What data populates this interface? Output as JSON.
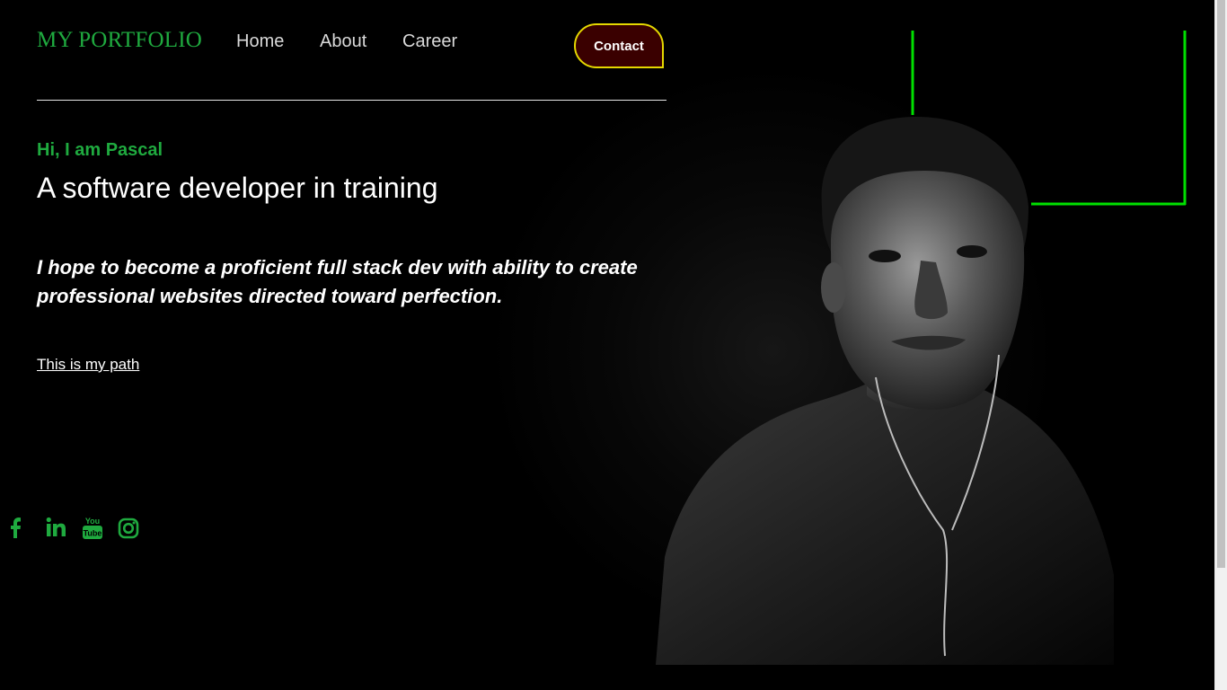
{
  "brand": {
    "logo_text": "MY PORTFOLIO"
  },
  "nav": {
    "home_label": "Home",
    "about_label": "About",
    "career_label": "Career",
    "contact_label": "Contact"
  },
  "hero": {
    "greeting": "Hi, I am Pascal",
    "headline": "A software developer in training",
    "tagline": "I hope to become a proficient full stack dev with ability to create professional websites directed toward perfection.",
    "path_link": "This is my path"
  },
  "social": [
    {
      "name": "facebook-icon"
    },
    {
      "name": "linkedin-icon"
    },
    {
      "name": "youtube-icon"
    },
    {
      "name": "instagram-icon"
    }
  ],
  "colors": {
    "background": "#000000",
    "accent_green": "#1faa3f",
    "frame_green": "#00e000",
    "contact_border": "#e5d800",
    "contact_fill": "#3a0000",
    "text_primary": "#ffffff",
    "nav_text": "#d9d9d9"
  }
}
